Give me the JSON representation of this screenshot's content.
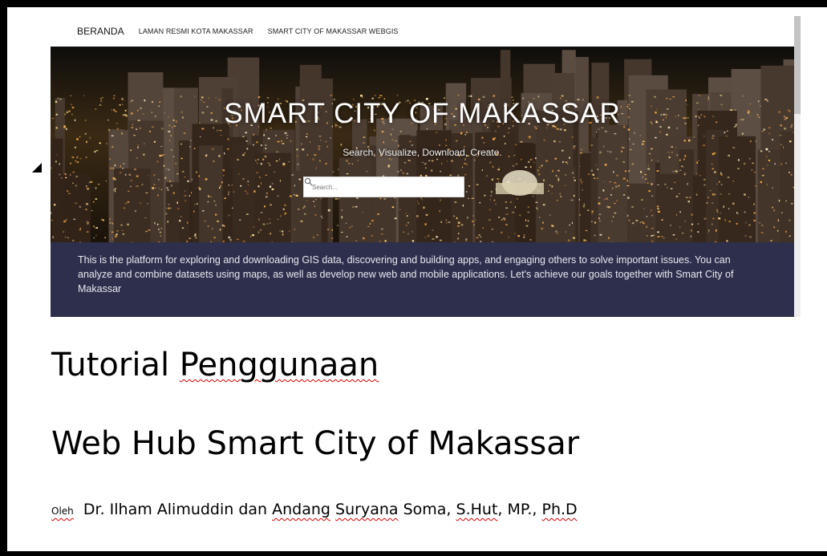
{
  "nav": {
    "home": "BERANDA",
    "items": [
      "LAMAN RESMI KOTA MAKASSAR",
      "SMART CITY OF MAKASSAR WEBGIS"
    ]
  },
  "hero": {
    "title": "SMART CITY OF MAKASSAR",
    "subtitle": "Search, Visualize, Download, Create.",
    "search_placeholder": "Search...",
    "search_icon": "search-icon"
  },
  "description": "This is the platform for exploring and downloading GIS data, discovering and building apps, and engaging others to solve important issues. You can analyze and combine datasets using maps, as well as develop new web and mobile applications. Let's achieve our goals together with Smart City of Makassar",
  "document": {
    "title_line1_a": "Tutorial ",
    "title_line1_b": "Penggunaan",
    "title_line2": "Web Hub Smart City of Makassar",
    "byline_oleh": "Oleh",
    "byline_1": "Dr. Ilham Alimuddin dan ",
    "byline_2": "Andang",
    "byline_3": " ",
    "byline_4": "Suryana",
    "byline_5": " Soma, ",
    "byline_6": "S.Hut",
    "byline_7": ", MP., ",
    "byline_8": "Ph.D"
  },
  "colors": {
    "description_band": "#2d2f4d",
    "frame": "#000000",
    "spellcheck": "#d40000"
  }
}
